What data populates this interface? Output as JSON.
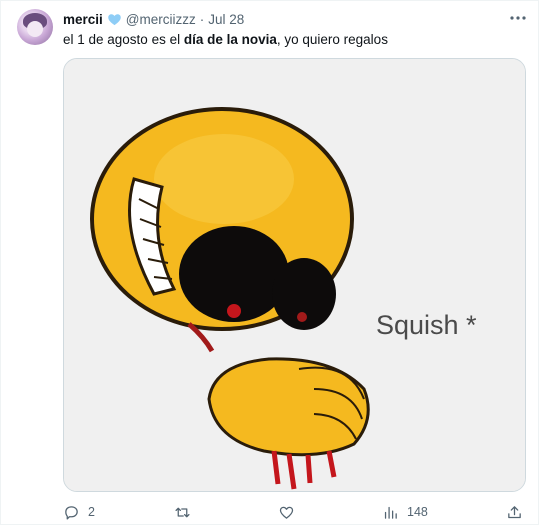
{
  "tweet": {
    "author_name": "mercii",
    "handle": "@merciizzz",
    "separator": "·",
    "date": "Jul 28",
    "text_prefix": "el 1 de agosto es el ",
    "text_bold": "día de la novia",
    "text_suffix": ", yo quiero regalos",
    "verified_color": "#8ecdf6"
  },
  "media": {
    "caption": "Squish *"
  },
  "actions": {
    "replies": "2",
    "retweets": "",
    "likes": "",
    "views": "148"
  },
  "icons": [
    "more-icon",
    "reply-icon",
    "retweet-icon",
    "like-icon",
    "views-icon",
    "share-icon"
  ],
  "colors": {
    "text": "#0f1419",
    "muted": "#536471",
    "border": "#cfd9de"
  }
}
